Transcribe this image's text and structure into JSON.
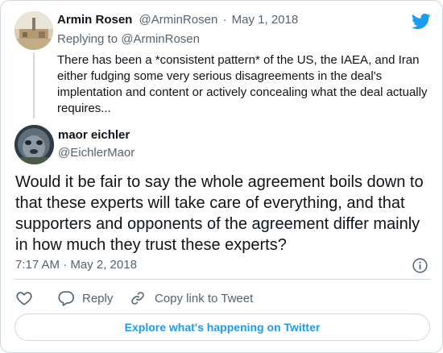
{
  "parent_tweet": {
    "author_name": "Armin Rosen",
    "author_handle": "@ArminRosen",
    "separator": "·",
    "date": "May 1, 2018",
    "replying_prefix": "Replying to",
    "replying_to": "@ArminRosen",
    "text": "There has been a *consistent pattern* of the US, the IAEA, and Iran either fudging some very serious disagreements in the deal's implentation and content or actively concealing what the deal actually requires..."
  },
  "main_tweet": {
    "author_name": "maor eichler",
    "author_handle": "@EichlerMaor",
    "text": "Would it be fair to say the whole agreement boils down to that these experts will take care of everything, and that supporters and opponents of the agreement differ mainly in how much they trust these experts?",
    "timestamp": "7:17 AM · May 2, 2018"
  },
  "actions": {
    "reply_label": "Reply",
    "copy_label": "Copy link to Tweet"
  },
  "explore_label": "Explore what's happening on Twitter",
  "icons": {
    "brand": "twitter-bird-icon",
    "like": "heart-icon",
    "reply": "speech-bubble-icon",
    "copy": "link-icon",
    "info": "info-icon"
  },
  "colors": {
    "brand_blue": "#1d9bf0",
    "text_primary": "#0f1419",
    "text_secondary": "#536471",
    "border": "#cfd9de"
  }
}
